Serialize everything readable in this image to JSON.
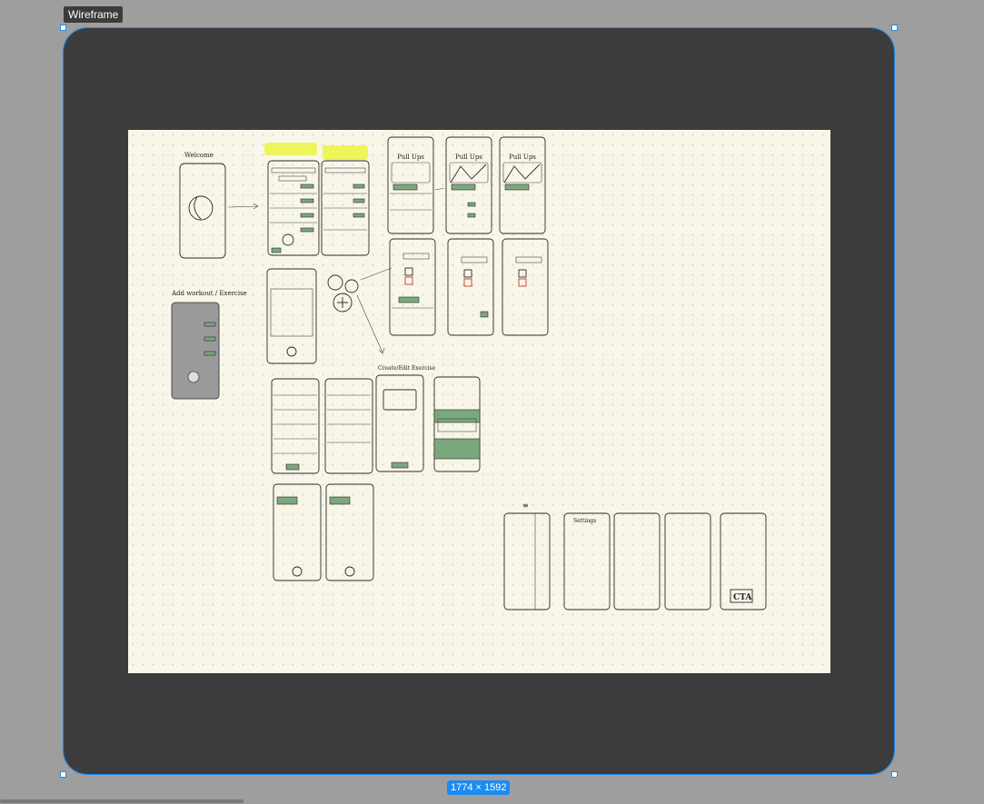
{
  "frame": {
    "label": "Wireframe",
    "size_readout": "1774 × 1592"
  },
  "canvas_notes": {
    "welcome": "Welcome",
    "add_workout": "Add workout / Exercise",
    "screen_title_pullups": "Pull Ups",
    "create_exercise": "Create/Edit Exercise",
    "settings": "Settings",
    "cta": "CTA"
  },
  "colors": {
    "selection": "#1b8cf2",
    "frame_bg": "#3c3c3c",
    "paper": "#f8f6e9",
    "accent_green": "#7aa87c",
    "highlight_yellow": "#eef55a"
  }
}
